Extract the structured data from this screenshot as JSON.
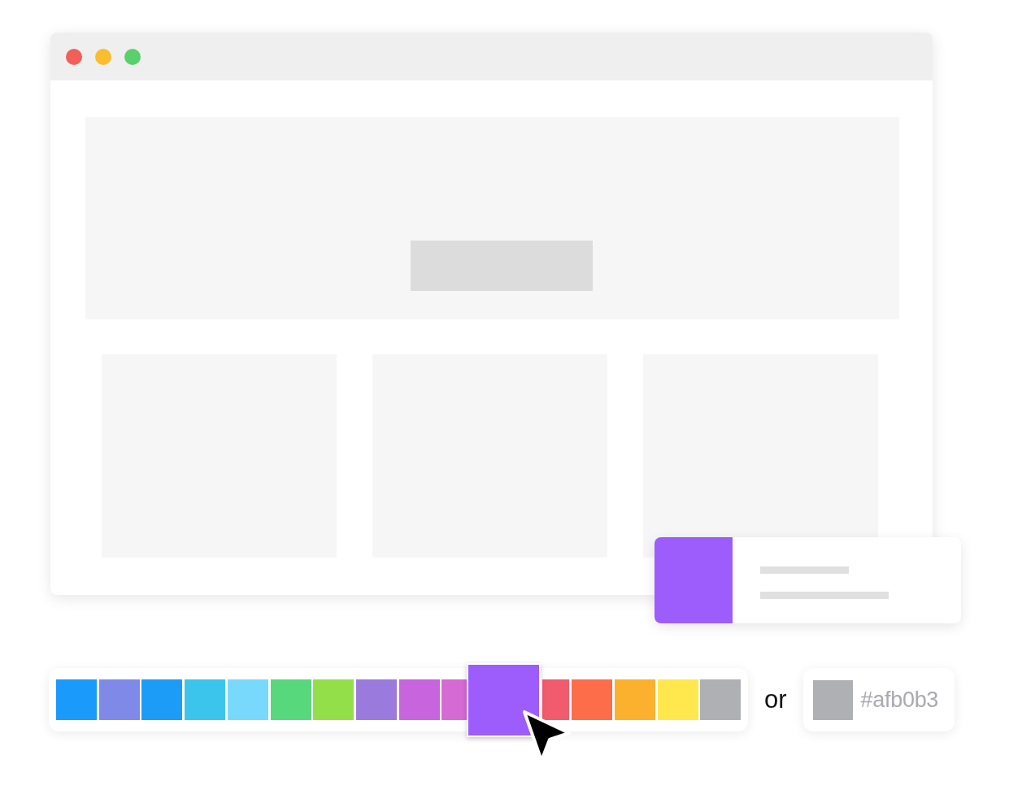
{
  "window": {
    "controls": [
      {
        "color": "#f25f58"
      },
      {
        "color": "#fbbc2e"
      },
      {
        "color": "#58d06c"
      }
    ]
  },
  "palette": {
    "swatches": [
      {
        "color": "#1a9bfc",
        "selected": false
      },
      {
        "color": "#7f8ae8",
        "selected": false
      },
      {
        "color": "#1c9cf6",
        "selected": false
      },
      {
        "color": "#3cc5ec",
        "selected": false
      },
      {
        "color": "#78d9fc",
        "selected": false
      },
      {
        "color": "#57d87c",
        "selected": false
      },
      {
        "color": "#93df4a",
        "selected": false
      },
      {
        "color": "#9b7ade",
        "selected": false
      },
      {
        "color": "#c864de",
        "selected": false
      },
      {
        "color": "#d66ad4",
        "selected": false
      },
      {
        "color": "#9d5cfc",
        "selected": true
      },
      {
        "color": "#f25b6e",
        "selected": false
      },
      {
        "color": "#fe6d4a",
        "selected": false
      },
      {
        "color": "#fcb12e",
        "selected": false
      },
      {
        "color": "#fee84e",
        "selected": false
      },
      {
        "color": "#afb0b3",
        "selected": false
      }
    ]
  },
  "separator": "or",
  "hex_field": {
    "color": "#afb0b3",
    "value": "#afb0b3"
  }
}
